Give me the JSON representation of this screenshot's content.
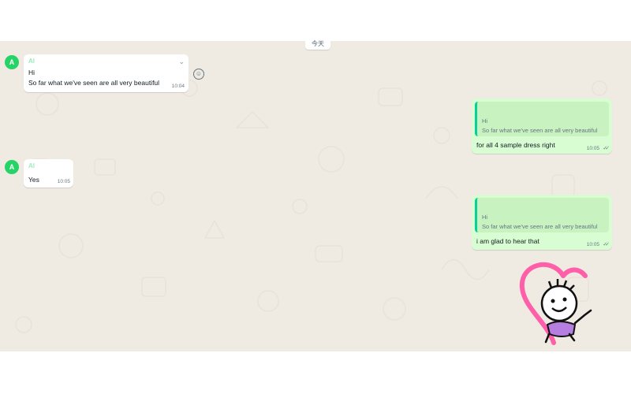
{
  "date_divider": "今天",
  "messages": [
    {
      "direction": "in",
      "avatar": "A",
      "sender": "Al",
      "text": "Hi",
      "text2": "So far what we've seen are all very beautiful",
      "time": "10:04"
    },
    {
      "direction": "out",
      "quote_line1": "Hi",
      "quote_line2": "So far what we've seen are all very beautiful",
      "text": "for all 4 sample dress right",
      "time": "10:05"
    },
    {
      "direction": "in",
      "avatar": "A",
      "sender": "Al",
      "text": "Yes",
      "time": "10:05"
    },
    {
      "direction": "out",
      "quote_line1": "Hi",
      "quote_line2": "So far what we've seen are all very beautiful",
      "text": "i am glad to hear that",
      "time": "10:05"
    }
  ],
  "icons": {
    "menu_chevron": "chevron-down-icon",
    "react": "emoji-icon",
    "read_receipt": "double-check-icon"
  },
  "colors": {
    "chat_background": "#efeae2",
    "incoming_bubble": "#ffffff",
    "outgoing_bubble": "#d9fdd3",
    "accent_green": "#25d366",
    "read_tick": "#667781"
  }
}
